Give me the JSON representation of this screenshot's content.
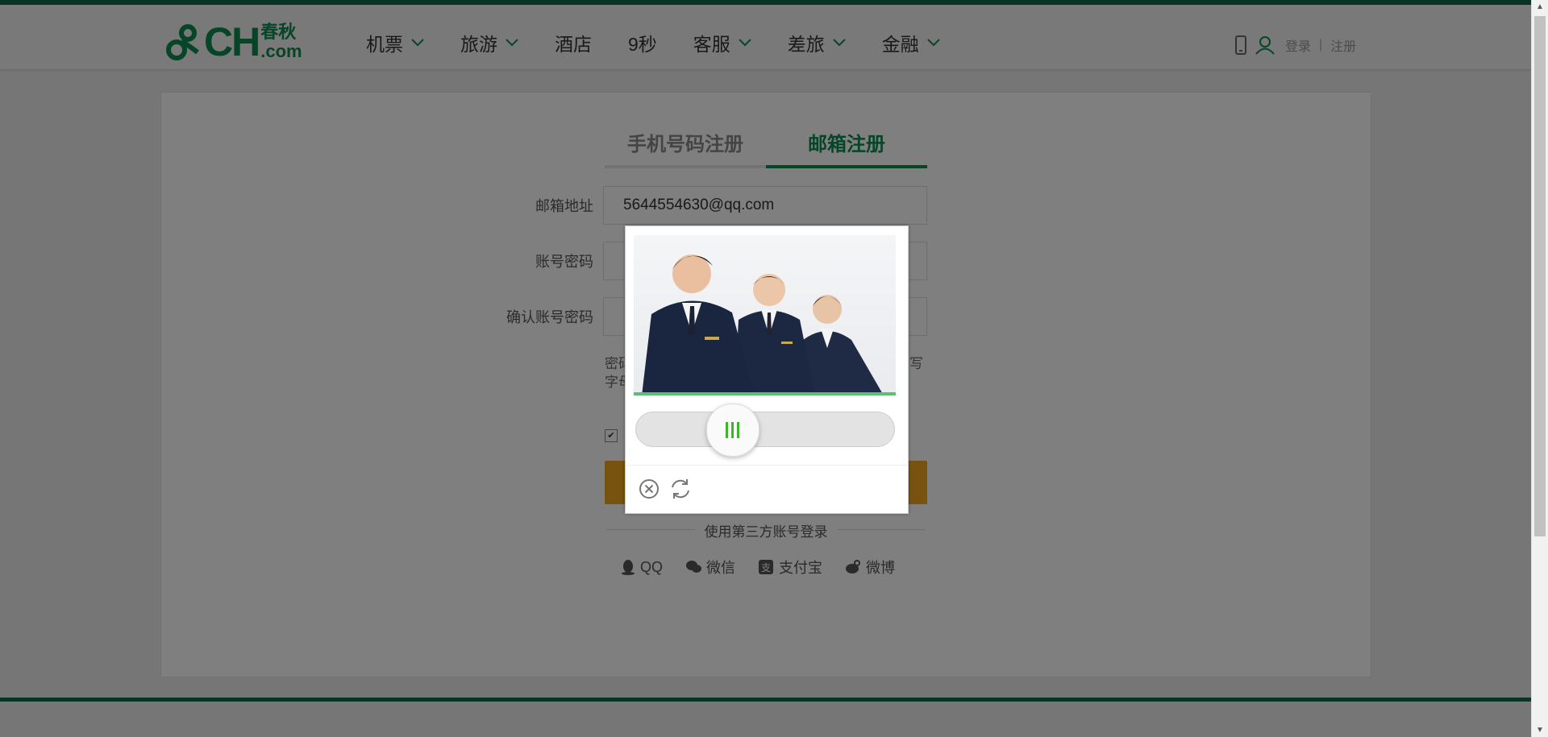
{
  "brand": {
    "logo_text": "CH",
    "logo_cn": "春秋",
    "logo_suffix": ".com"
  },
  "nav": [
    {
      "label": "机票",
      "dropdown": true
    },
    {
      "label": "旅游",
      "dropdown": true
    },
    {
      "label": "酒店",
      "dropdown": false
    },
    {
      "label": "9秒",
      "dropdown": false
    },
    {
      "label": "客服",
      "dropdown": true
    },
    {
      "label": "差旅",
      "dropdown": true
    },
    {
      "label": "金融",
      "dropdown": true
    }
  ],
  "user": {
    "login": "登录",
    "separator": "|",
    "register": "注册"
  },
  "tabs": [
    {
      "label": "手机号码注册",
      "active": false
    },
    {
      "label": "邮箱注册",
      "active": true
    }
  ],
  "form": {
    "email_label": "邮箱地址",
    "email_value": "5644554630@qq.com",
    "password_label": "账号密码",
    "confirm_label": "确认账号密码",
    "hint_partial": "密码\n字母",
    "hint_right": "写"
  },
  "third_party": {
    "title": "使用第三方账号登录",
    "items": [
      "QQ",
      "微信",
      "支付宝",
      "微博"
    ]
  },
  "captcha": {
    "slider_progress": 0.34
  },
  "colors": {
    "brand_green": "#0d8a50",
    "header_line": "#12664a",
    "submit_orange": "#f0a51e",
    "slider_green": "#3cb52d"
  }
}
